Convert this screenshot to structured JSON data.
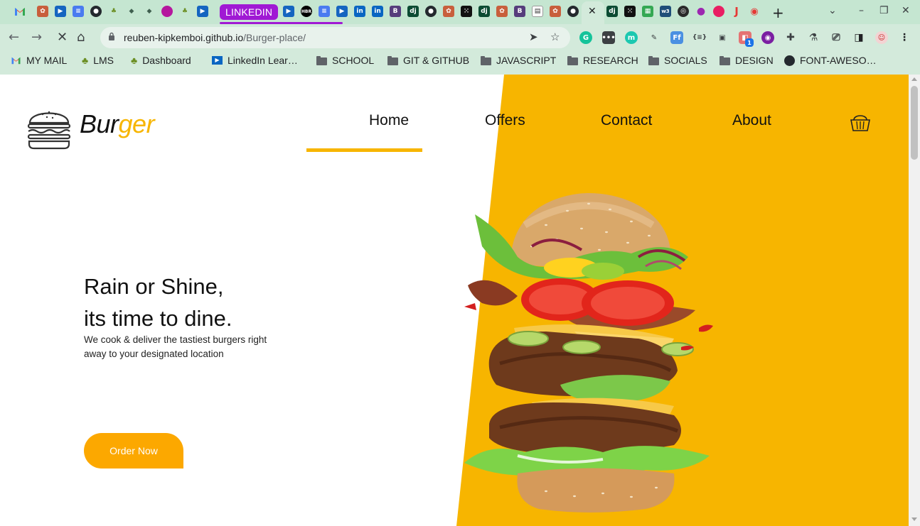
{
  "browser": {
    "tab_group_label": "LINKEDIN",
    "url_host": "reuben-kipkemboi.github.io",
    "url_path": "/Burger-place/",
    "bookmarks": [
      {
        "label": "MY MAIL",
        "icon": "gmail-icon"
      },
      {
        "label": "LMS",
        "icon": "tree-icon"
      },
      {
        "label": "Dashboard",
        "icon": "tree-icon"
      },
      {
        "label": "LinkedIn Lear…",
        "icon": "linkedin-learning-icon"
      },
      {
        "label": "SCHOOL",
        "icon": "folder-icon"
      },
      {
        "label": "GIT & GITHUB",
        "icon": "folder-icon"
      },
      {
        "label": "JAVASCRIPT",
        "icon": "folder-icon"
      },
      {
        "label": "RESEARCH",
        "icon": "folder-icon"
      },
      {
        "label": "SOCIALS",
        "icon": "folder-icon"
      },
      {
        "label": "DESIGN",
        "icon": "folder-icon"
      },
      {
        "label": "FONT-AWESO…",
        "icon": "github-icon"
      }
    ],
    "extension_badge": "1",
    "accent": "#a019d4"
  },
  "site": {
    "logo_part1": "Bur",
    "logo_part2": "ger",
    "nav": [
      "Home",
      "Offers",
      "Contact",
      "About"
    ],
    "active_nav": "Home",
    "hero_line1": "Rain or Shine,",
    "hero_line2": "its time to dine.",
    "hero_sub": "We cook & deliver the tastiest burgers right away to your designated location",
    "cta": "Order Now",
    "colors": {
      "accent": "#f7b500",
      "button": "#fca800",
      "text": "#111111"
    }
  }
}
